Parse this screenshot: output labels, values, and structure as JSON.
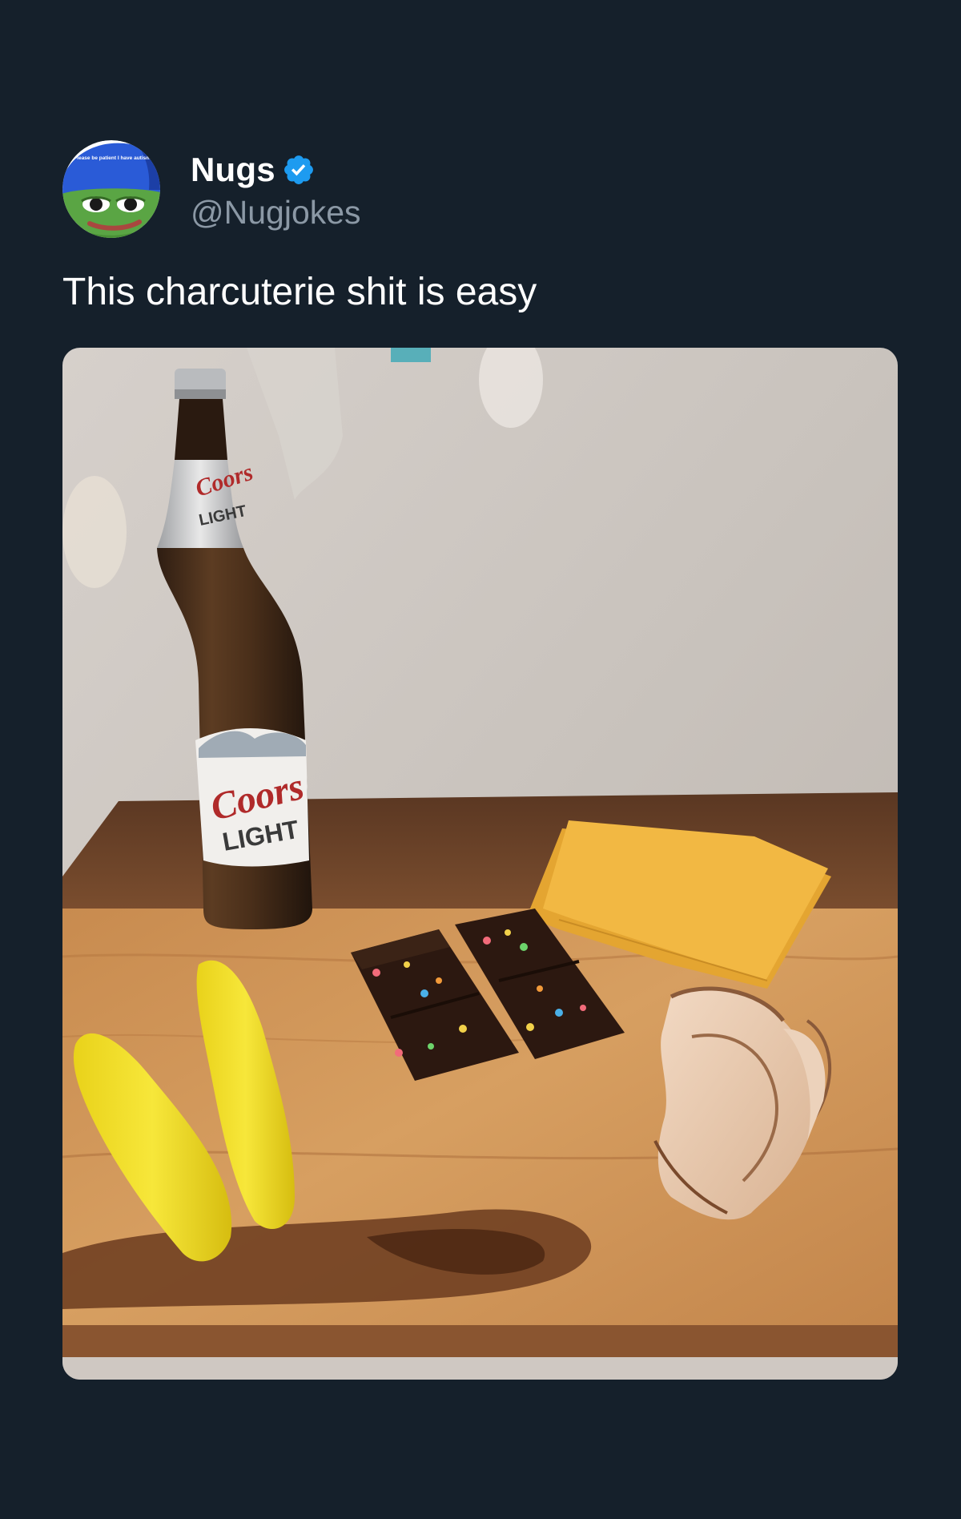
{
  "tweet": {
    "display_name": "Nugs",
    "handle": "@Nugjokes",
    "text": "This charcuterie shit is easy",
    "verified": true,
    "avatar_caption": "Please be patient I have autism"
  },
  "media": {
    "bottle_label_top": "Coors",
    "bottle_label_top_sub": "LIGHT",
    "bottle_label_main": "Coors",
    "bottle_label_main_sub": "LIGHT"
  },
  "colors": {
    "background": "#15202b",
    "text_primary": "#ffffff",
    "text_secondary": "#8b98a5",
    "verified_badge": "#1d9bf0"
  }
}
